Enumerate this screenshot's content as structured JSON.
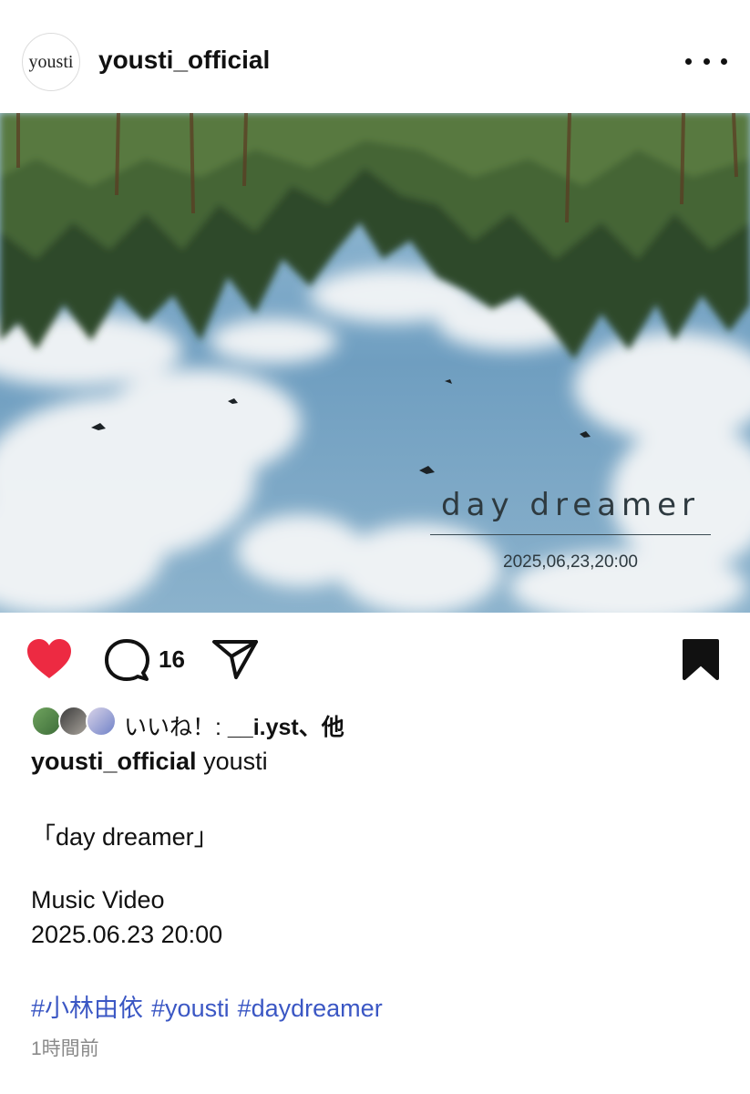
{
  "post": {
    "username": "yousti_official",
    "avatar_text": "yousti",
    "more_icon": "more-horizontal-icon",
    "media": {
      "title": "day dreamer",
      "date": "2025,06,23,20:00"
    },
    "actions": {
      "like_icon": "heart-filled-icon",
      "comment_icon": "comment-icon",
      "comment_count": "16",
      "share_icon": "send-icon",
      "save_icon": "bookmark-filled-icon",
      "like_color": "#ed2a42"
    },
    "likes": {
      "prefix": "いいね！: ",
      "user": "__i.yst",
      "suffix": "、他"
    },
    "caption": {
      "username": "yousti_official",
      "text": "yousti",
      "lines": [
        "「day dreamer」",
        "Music Video",
        "2025.06.23 20:00"
      ],
      "hashtags": [
        "#小林由依",
        "#yousti",
        "#daydreamer"
      ],
      "hashtag_color": "#3b57c4"
    },
    "time_ago": "1時間前"
  }
}
